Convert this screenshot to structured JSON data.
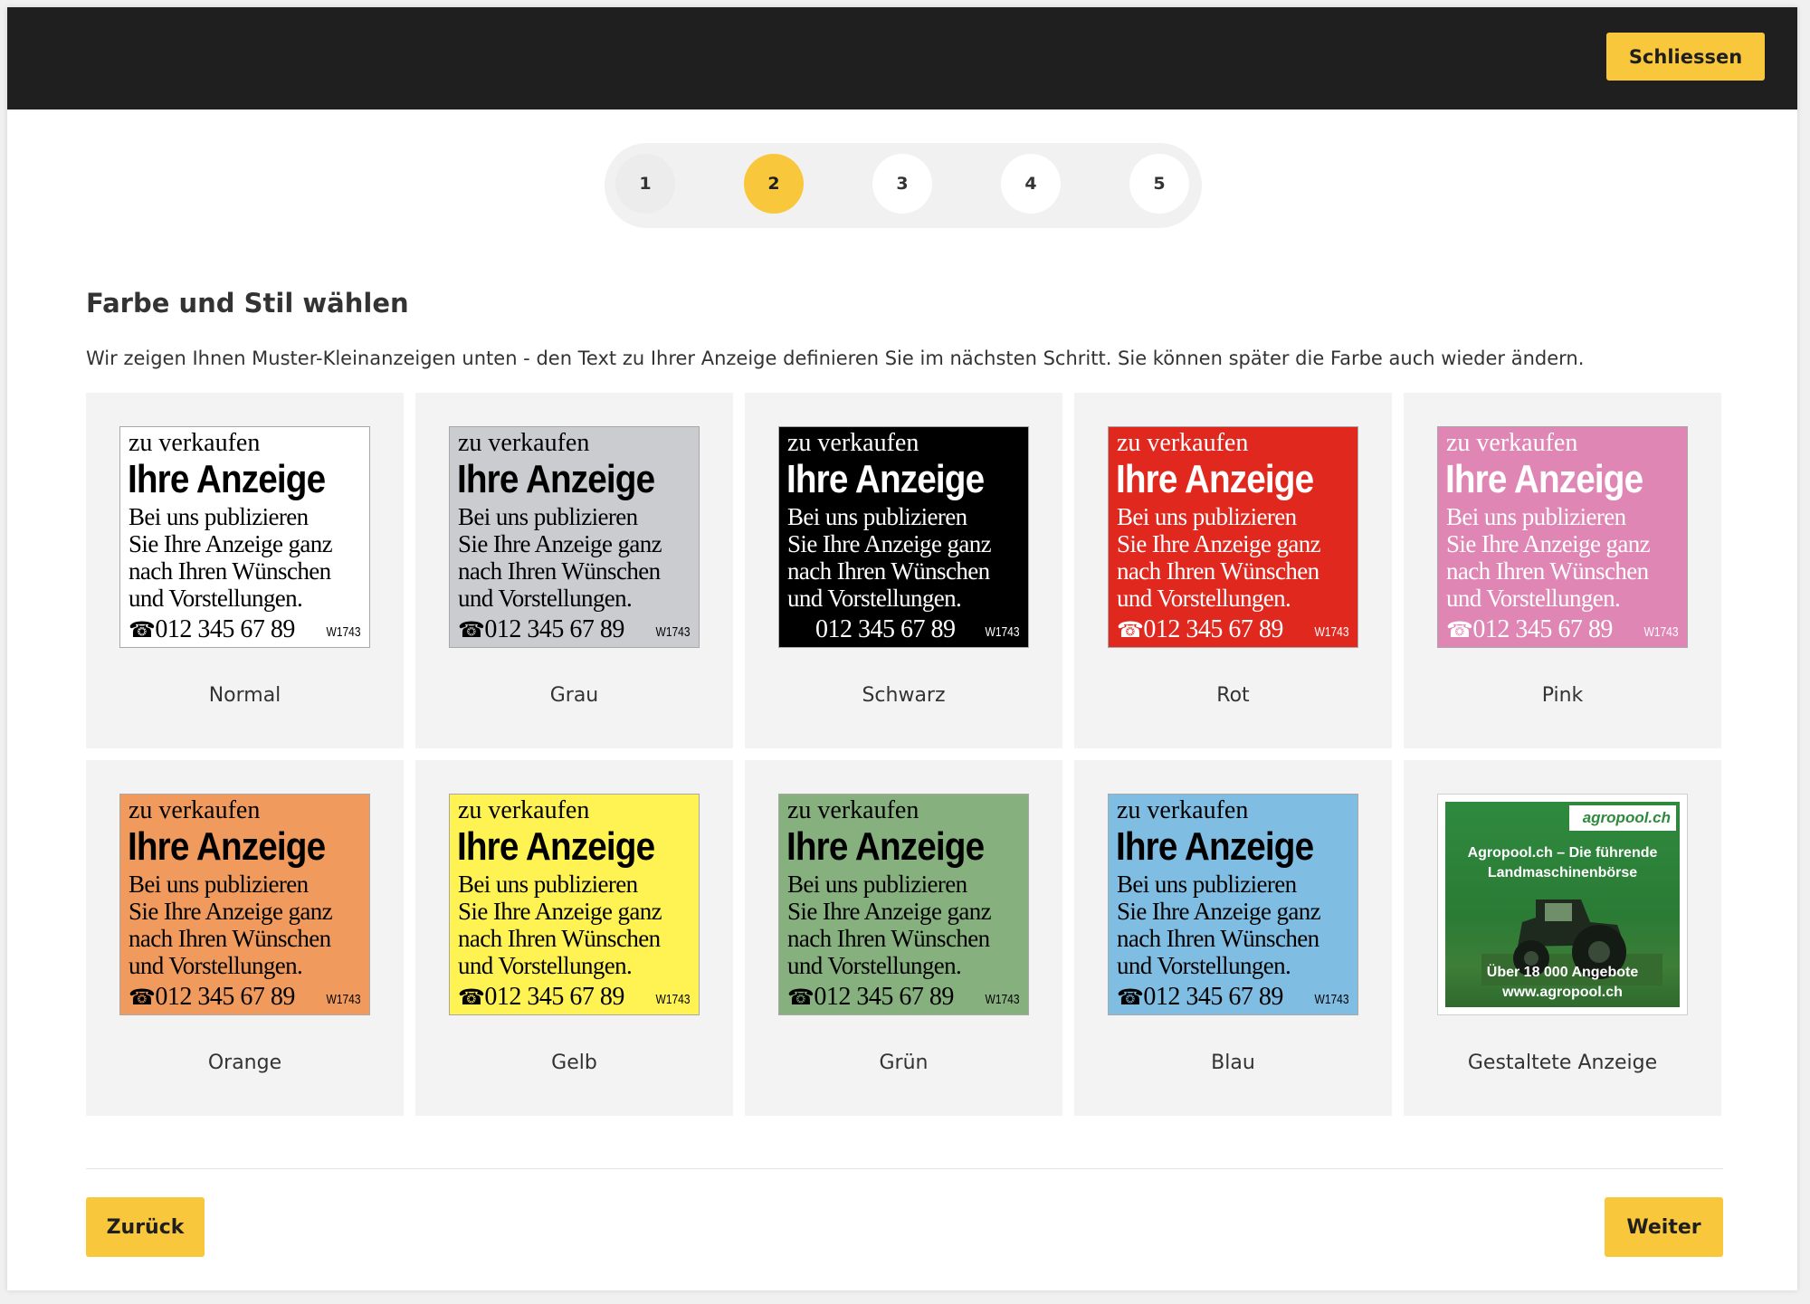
{
  "topbar": {
    "close_label": "Schliessen"
  },
  "stepper": {
    "steps": [
      "1",
      "2",
      "3",
      "4",
      "5"
    ],
    "active_step": "2"
  },
  "section": {
    "title": "Farbe und Stil wählen",
    "description": "Wir zeigen Ihnen Muster-Kleinanzeigen unten - den Text zu Ihrer Anzeige definieren Sie im nächsten Schritt. Sie können später die Farbe auch wieder ändern."
  },
  "sample_ad": {
    "category": "zu verkaufen",
    "headline": "Ihre Anzeige",
    "body_lines": [
      "Bei uns publizieren",
      "Sie Ihre Anzeige ganz",
      "nach Ihren Wünschen",
      "und Vorstellungen."
    ],
    "phone_icon": "telephone-icon",
    "phone": "012 345 67 89",
    "code": "W1743"
  },
  "styles": [
    {
      "label": "Normal",
      "bg": "#ffffff",
      "fg": "#000000",
      "phone_icon": true
    },
    {
      "label": "Grau",
      "bg": "#cbcccf",
      "fg": "#000000",
      "phone_icon": true
    },
    {
      "label": "Schwarz",
      "bg": "#000000",
      "fg": "#ffffff",
      "phone_icon": false
    },
    {
      "label": "Rot",
      "bg": "#e0281e",
      "fg": "#ffffff",
      "phone_icon": true
    },
    {
      "label": "Pink",
      "bg": "#df86b5",
      "fg": "#ffffff",
      "phone_icon": true
    },
    {
      "label": "Orange",
      "bg": "#f09a5d",
      "fg": "#000000",
      "phone_icon": true
    },
    {
      "label": "Gelb",
      "bg": "#fff253",
      "fg": "#000000",
      "phone_icon": true
    },
    {
      "label": "Grün",
      "bg": "#86b07d",
      "fg": "#000000",
      "phone_icon": true
    },
    {
      "label": "Blau",
      "bg": "#7fbde2",
      "fg": "#000000",
      "phone_icon": true
    }
  ],
  "designed_ad": {
    "label": "Gestaltete Anzeige",
    "logo": "agropool.ch",
    "headline_lines": [
      "Agropool.ch – Die führende",
      "Landmaschinenbörse"
    ],
    "offers_lines": [
      "Über 18 000 Angebote",
      "www.agropool.ch"
    ],
    "image": "tractor-icon"
  },
  "footer": {
    "back_label": "Zurück",
    "next_label": "Weiter"
  },
  "colors": {
    "accent": "#f9c73b",
    "topbar": "#1f1f1f",
    "card_bg": "#f3f3f3"
  }
}
